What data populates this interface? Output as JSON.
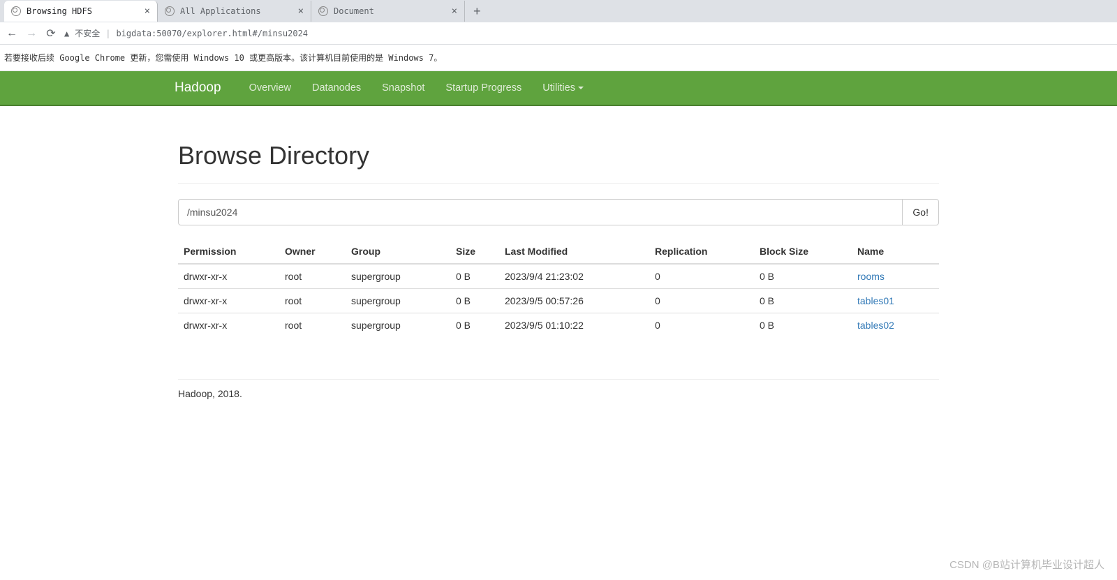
{
  "browser": {
    "tabs": [
      {
        "title": "Browsing HDFS",
        "active": true
      },
      {
        "title": "All Applications",
        "active": false
      },
      {
        "title": "Document",
        "active": false
      }
    ],
    "insecure_label": "不安全",
    "url": "bigdata:50070/explorer.html#/minsu2024"
  },
  "banner": "若要接收后续 Google Chrome 更新，您需使用 Windows 10 或更高版本。该计算机目前使用的是 Windows 7。",
  "nav": {
    "brand": "Hadoop",
    "items": [
      "Overview",
      "Datanodes",
      "Snapshot",
      "Startup Progress",
      "Utilities"
    ]
  },
  "page": {
    "title": "Browse Directory",
    "path_value": "/minsu2024",
    "go_label": "Go!",
    "columns": [
      "Permission",
      "Owner",
      "Group",
      "Size",
      "Last Modified",
      "Replication",
      "Block Size",
      "Name"
    ],
    "rows": [
      {
        "permission": "drwxr-xr-x",
        "owner": "root",
        "group": "supergroup",
        "size": "0 B",
        "modified": "2023/9/4 21:23:02",
        "replication": "0",
        "block_size": "0 B",
        "name": "rooms"
      },
      {
        "permission": "drwxr-xr-x",
        "owner": "root",
        "group": "supergroup",
        "size": "0 B",
        "modified": "2023/9/5 00:57:26",
        "replication": "0",
        "block_size": "0 B",
        "name": "tables01"
      },
      {
        "permission": "drwxr-xr-x",
        "owner": "root",
        "group": "supergroup",
        "size": "0 B",
        "modified": "2023/9/5 01:10:22",
        "replication": "0",
        "block_size": "0 B",
        "name": "tables02"
      }
    ],
    "footer": "Hadoop, 2018."
  },
  "watermark": "CSDN @B站计算机毕业设计超人"
}
